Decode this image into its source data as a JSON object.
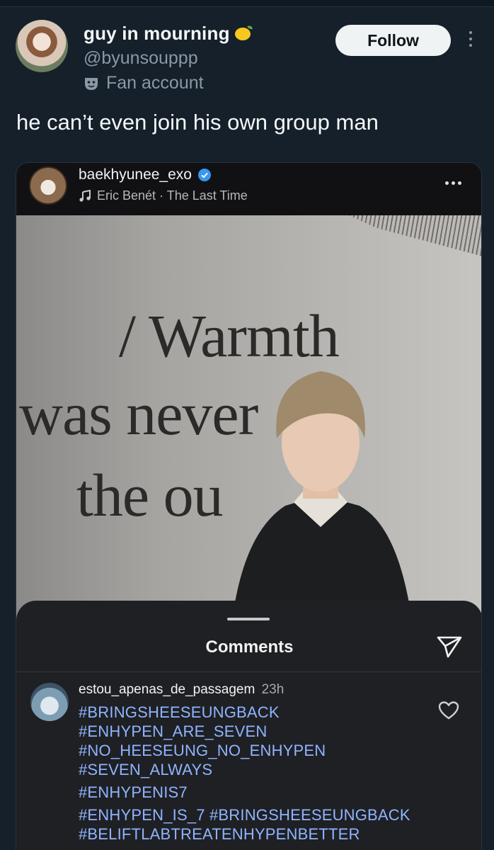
{
  "tweet": {
    "display_name": "guy in mourning",
    "handle": "@byunsouppp",
    "badge_label": "Fan account",
    "follow_label": "Follow",
    "text": "he can’t even join his own group man"
  },
  "embed": {
    "username": "baekhyunee_exo",
    "music": "Eric Benét · The Last Time",
    "wall_text": [
      "/ Warmth",
      "was never",
      "the ou"
    ],
    "comments_title": "Comments",
    "comment": {
      "username": "estou_apenas_de_passagem",
      "time": "23h",
      "lines": [
        "#BRINGSHEESEUNGBACK",
        "#ENHYPEN_ARE_SEVEN",
        "#NO_HEESEUNG_NO_ENHYPEN",
        "#SEVEN_ALWAYS",
        "#ENHYPENIS7",
        "#ENHYPEN_IS_7 #BRINGSHEESEUNGBACK",
        "#BELIFTLABTREATENHYPENBETTER"
      ]
    }
  },
  "icons": [
    "lemon-icon",
    "mask-icon",
    "more-vertical-icon",
    "verified-icon",
    "music-note-icon",
    "more-horizontal-icon",
    "send-icon",
    "heart-icon"
  ],
  "colors": {
    "background": "#15202b",
    "hashtag": "#8fb4ff",
    "verified": "#3897f0"
  }
}
